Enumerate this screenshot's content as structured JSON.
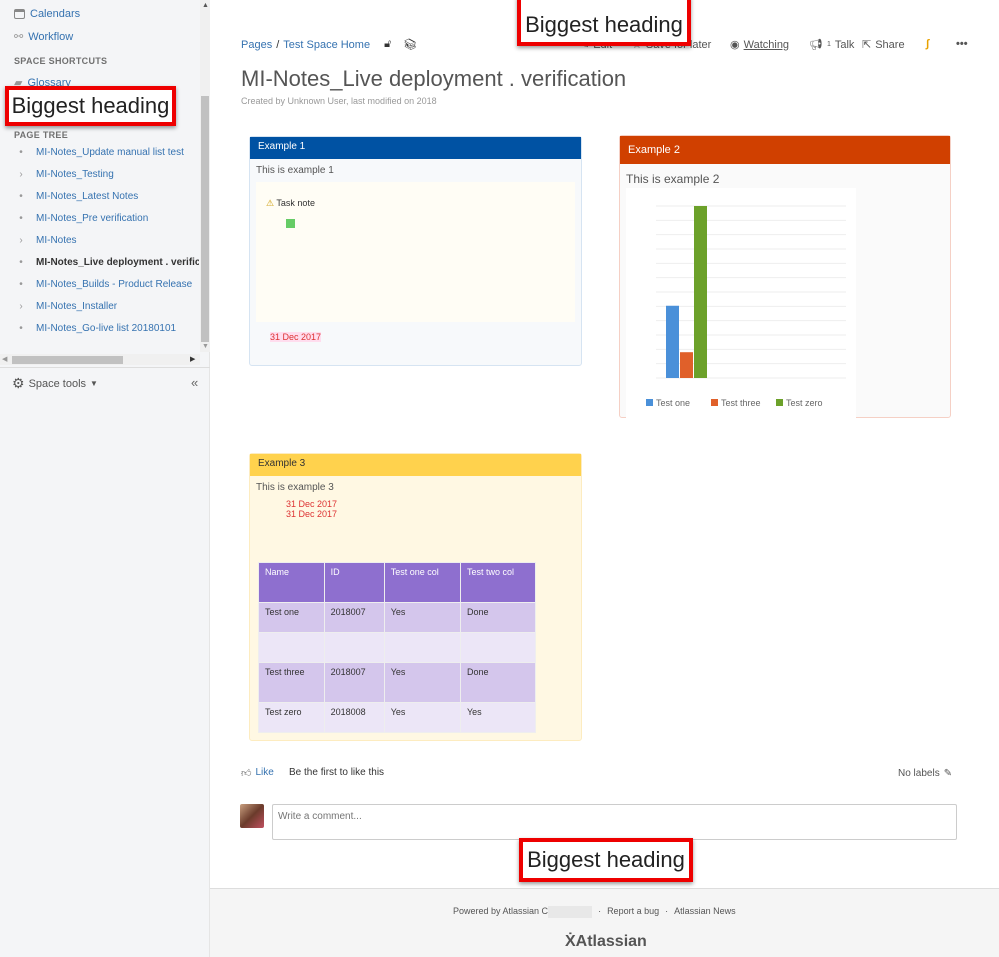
{
  "sidebar": {
    "links": [
      {
        "label": "Calendars",
        "icon": "calendar-icon"
      },
      {
        "label": "Workflow",
        "icon": "workflow-icon"
      }
    ],
    "shortcuts_heading": "SPACE SHORTCUTS",
    "shortcut": {
      "label": "Glossary",
      "icon": "book-icon"
    },
    "page_tree_heading": "PAGE TREE",
    "tree": [
      {
        "marker": "•",
        "label": "MI-Notes_Update manual list test"
      },
      {
        "marker": "›",
        "label": "MI-Notes_Testing"
      },
      {
        "marker": "•",
        "label": "MI-Notes_Latest Notes"
      },
      {
        "marker": "•",
        "label": "MI-Notes_Pre verification"
      },
      {
        "marker": "›",
        "label": "MI-Notes"
      },
      {
        "marker": "•",
        "label": "MI-Notes_Live deployment . verification",
        "current": true
      },
      {
        "marker": "•",
        "label": "MI-Notes_Builds - Product Release"
      },
      {
        "marker": "›",
        "label": "MI-Notes_Installer"
      },
      {
        "marker": "•",
        "label": "MI-Notes_Go-live list 20180101"
      }
    ],
    "space_tools": "Space tools",
    "collapse": "«"
  },
  "breadcrumb": {
    "pages": "Pages",
    "sep": "/",
    "home": "Test Space Home"
  },
  "toolbar": {
    "edit": "Edit",
    "save": "Save for later",
    "watching": "Watching",
    "talk": "Talk",
    "talk_count": "1",
    "share": "Share",
    "more": "•••"
  },
  "page": {
    "title": "MI-Notes_Live deployment . verification",
    "byline": "Created by Unknown User, last modified on 2018"
  },
  "panels": [
    {
      "title": "Example 1",
      "body": "This is example 1",
      "note": "Task note",
      "status": "31 Dec 2017",
      "color": "#0052a3"
    },
    {
      "title": "Example 2",
      "body": "This is example 2",
      "color": "#d04000",
      "chart_values": [
        0.42,
        0.15,
        1.0
      ],
      "series_colors": [
        "#4a90d9",
        "#e0602a",
        "#6ca12a"
      ],
      "legend": [
        "Test one",
        "Test three",
        "Test zero"
      ]
    },
    {
      "title": "Example 3",
      "body": "This is example 3",
      "dates": [
        "31 Dec 2017",
        "31 Dec 2017"
      ],
      "color": "#ffd24d",
      "table": {
        "headers": [
          "Name",
          "ID",
          "Test one col",
          "Test two col"
        ],
        "rows": [
          [
            "Test one",
            "2018007",
            "Yes",
            "Done"
          ],
          [
            "",
            "",
            "",
            ""
          ],
          [
            "Test three",
            "2018007",
            "Yes",
            "Done"
          ],
          [
            "Test zero",
            "2018008",
            "Yes",
            "Yes"
          ]
        ]
      }
    }
  ],
  "like": {
    "label": "Like",
    "text": "Be the first to like this"
  },
  "labels": {
    "text": "No labels"
  },
  "comment": {
    "placeholder": "Write a comment..."
  },
  "footer": {
    "powered": "Powered by Atlassian C",
    "bug": "Report a bug",
    "news": "Atlassian News",
    "logo": "Atlassian",
    "dot": "·"
  },
  "annotations": [
    "Biggest heading",
    "Biggest heading",
    "Biggest heading"
  ]
}
